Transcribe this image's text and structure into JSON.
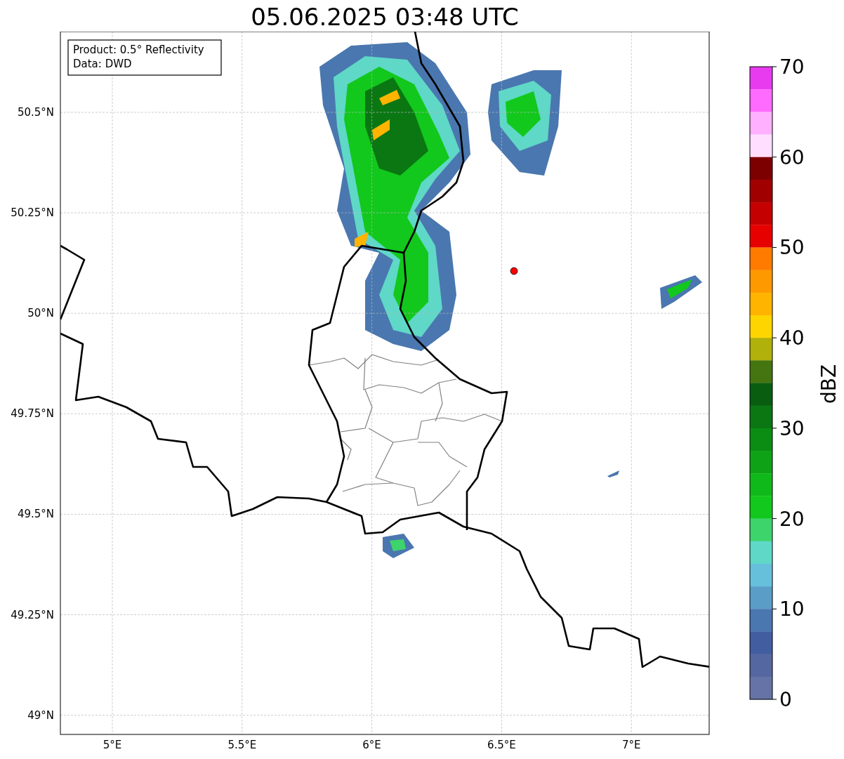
{
  "title": "05.06.2025 03:48 UTC",
  "legend": [
    "Product: 0.5° Reflectivity",
    "Data: DWD"
  ],
  "map": {
    "lat_labels": [
      "50.5°N",
      "50.25°N",
      "50°N",
      "49.75°N",
      "49.5°N",
      "49.25°N",
      "49°N"
    ],
    "lon_labels": [
      "5°E",
      "5.5°E",
      "6°E",
      "6.5°E",
      "7°E"
    ]
  },
  "colorbar": {
    "label": "dBZ",
    "ticks": [
      "70",
      "60",
      "50",
      "40",
      "30",
      "20",
      "10",
      "0"
    ],
    "bins": [
      {
        "color": "#e83aef"
      },
      {
        "color": "#ff6aff"
      },
      {
        "color": "#ffb0ff"
      },
      {
        "color": "#ffdeff"
      },
      {
        "color": "#7d0000"
      },
      {
        "color": "#a00000"
      },
      {
        "color": "#c40000"
      },
      {
        "color": "#e60000"
      },
      {
        "color": "#ff7b00"
      },
      {
        "color": "#ff9900"
      },
      {
        "color": "#ffb400"
      },
      {
        "color": "#ffd500"
      },
      {
        "color": "#b0b10a"
      },
      {
        "color": "#457510"
      },
      {
        "color": "#095d10"
      },
      {
        "color": "#0a7713"
      },
      {
        "color": "#0b8d14"
      },
      {
        "color": "#0ea316"
      },
      {
        "color": "#10b91a"
      },
      {
        "color": "#12c81c"
      },
      {
        "color": "#3dd46c"
      },
      {
        "color": "#5fd8c7"
      },
      {
        "color": "#66c0dc"
      },
      {
        "color": "#5a9ec8"
      },
      {
        "color": "#4a77af"
      },
      {
        "color": "#425ea0"
      },
      {
        "color": "#5567a0"
      },
      {
        "color": "#6673a6"
      }
    ]
  }
}
